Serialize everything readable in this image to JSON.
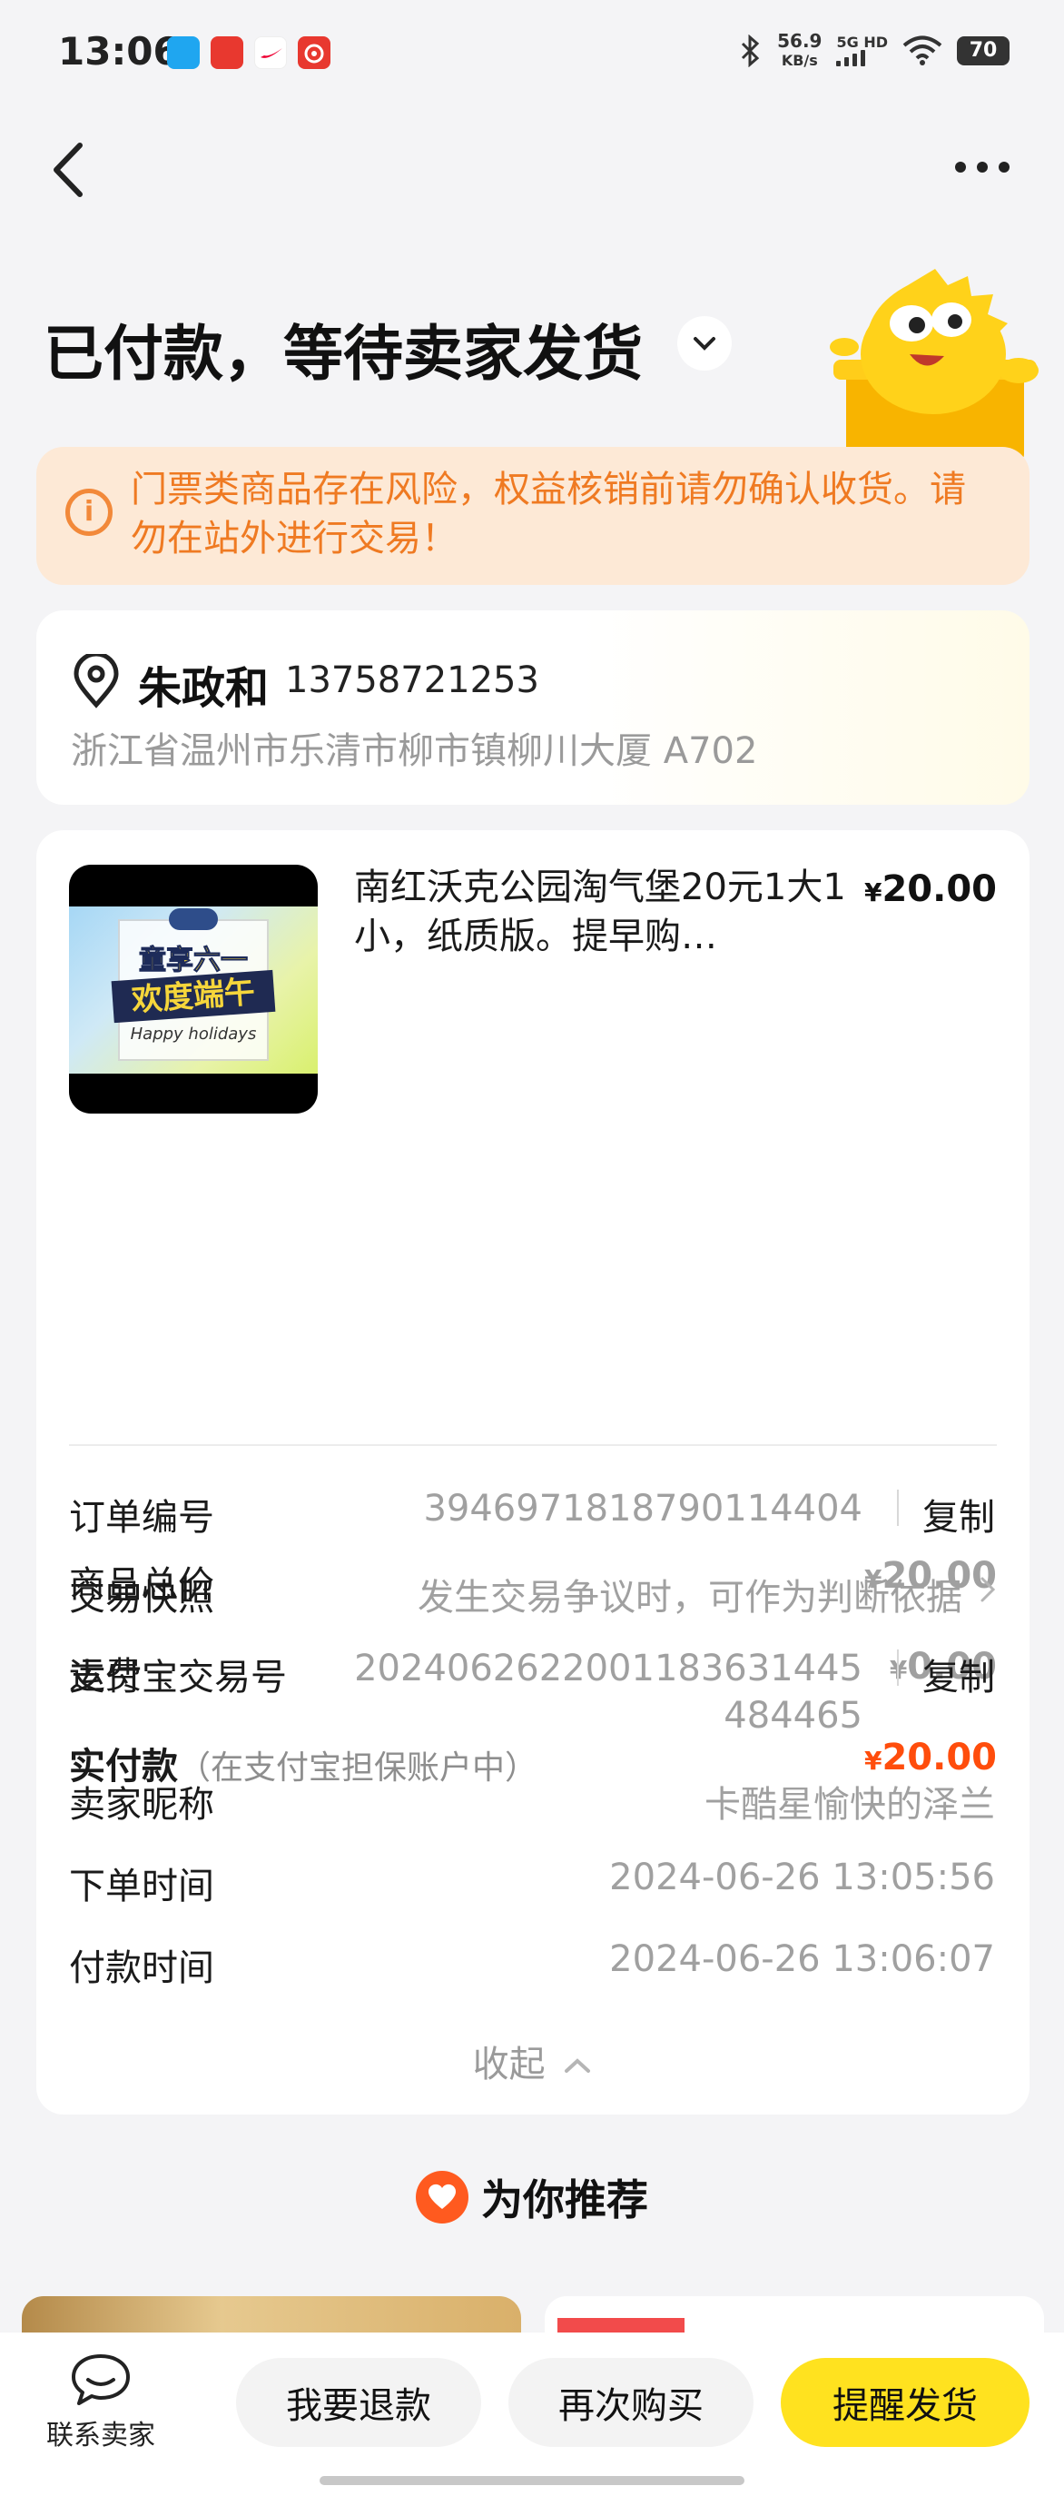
{
  "status_bar": {
    "time": "13:06",
    "net_speed_value": "56.9",
    "net_speed_unit": "KB/s",
    "network": "5G HD",
    "battery": "70",
    "app_icons": [
      "app-icon-blue",
      "app-icon-bank",
      "app-icon-nike",
      "app-icon-red"
    ],
    "icons": [
      "bluetooth-icon",
      "signal-icon",
      "wifi-icon",
      "battery-icon"
    ]
  },
  "nav": {
    "back_icon": "back-arrow-icon",
    "more_icon": "more-icon"
  },
  "header": {
    "status_title": "已付款，等待卖家发货",
    "chevron_icon": "chevron-down-icon"
  },
  "warning": {
    "icon": "info-icon",
    "text": "门票类商品存在风险，权益核销前请勿确认收货。请勿在站外进行交易！",
    "color": "#ef7a22"
  },
  "address": {
    "icon": "location-pin-icon",
    "name": "朱政和",
    "phone": "13758721253",
    "detail": "浙江省温州市乐清市柳市镇柳川大厦 A702"
  },
  "product": {
    "image_text_1": "童享六一",
    "image_text_2": "欢度端午",
    "image_text_3": "Happy holidays",
    "title": "南红沃克公园淘气堡20元1大1小，纸质版。提早购…",
    "currency": "¥",
    "price": "20.00"
  },
  "price_summary": {
    "total_label": "商品总价",
    "total_value": "20.00",
    "shipping_label": "运费",
    "shipping_value": "0.00",
    "paid_label": "实付款",
    "paid_note": "（在支付宝担保账户中）",
    "paid_value": "20.00",
    "paid_color": "#ff4d0c"
  },
  "order_info": {
    "order_no_label": "订单编号",
    "order_no_value": "3946971818790114404",
    "copy_label": "复制",
    "snapshot_label": "交易快照",
    "snapshot_value": "发生交易争议时，可作为判断依据",
    "alipay_no_label": "支付宝交易号",
    "alipay_no_line1": "2024062622001183631445",
    "alipay_no_line2": "484465",
    "seller_label": "卖家昵称",
    "seller_value": "卡酷星愉快的泽兰",
    "order_time_label": "下单时间",
    "order_time_value": "2024-06-26 13:05:56",
    "pay_time_label": "付款时间",
    "pay_time_value": "2024-06-26 13:06:07",
    "collapse_label": "收起"
  },
  "recommend": {
    "icon": "heart-icon",
    "title": "为你推荐"
  },
  "bottom_bar": {
    "contact_icon": "chat-bubble-icon",
    "contact_label": "联系卖家",
    "refund_label": "我要退款",
    "rebuy_label": "再次购买",
    "remind_label": "提醒发货",
    "accent": "#ffe21f"
  }
}
